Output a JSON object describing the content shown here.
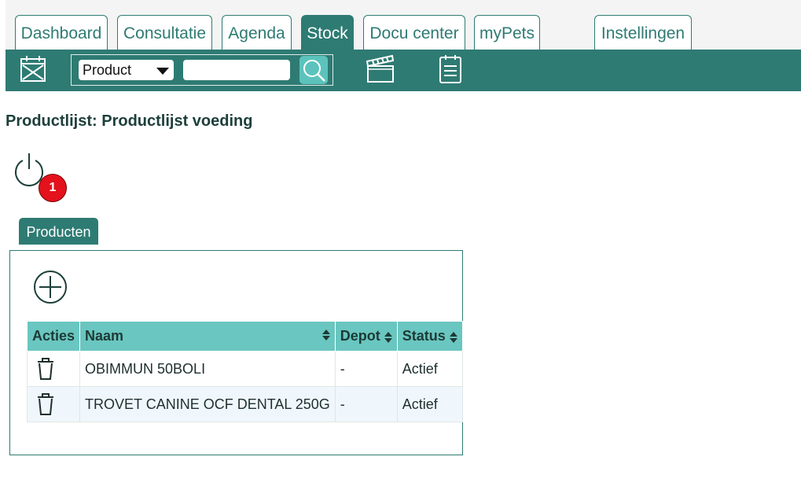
{
  "tabs": [
    {
      "label": "Dashboard"
    },
    {
      "label": "Consultatie"
    },
    {
      "label": "Agenda"
    },
    {
      "label": "Stock"
    },
    {
      "label": "Docu center"
    },
    {
      "label": "myPets"
    },
    {
      "label": "Instellingen"
    }
  ],
  "active_tab": "Stock",
  "toolbar": {
    "search_type": "Product",
    "search_value": "",
    "icons": [
      "calendar-icon",
      "search-icon",
      "clapperboard-icon",
      "clipboard-icon"
    ]
  },
  "page": {
    "title": "Productlijst: Productlijst voeding",
    "notification_count": "1"
  },
  "panel": {
    "tab_label": "Producten"
  },
  "table": {
    "headers": [
      "Acties",
      "Naam",
      "Depot",
      "Status"
    ],
    "rows": [
      {
        "naam": "OBIMMUN 50BOLI",
        "depot": "-",
        "status": "Actief"
      },
      {
        "naam": "TROVET CANINE OCF DENTAL 250G",
        "depot": "-",
        "status": "Actief"
      }
    ]
  },
  "colors": {
    "primary": "#2e7b73",
    "header": "#6ac6c0",
    "badge": "#e3121c"
  }
}
